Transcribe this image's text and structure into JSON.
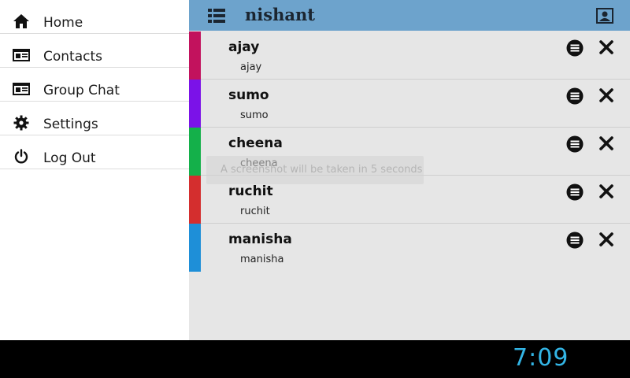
{
  "sidebar": {
    "items": [
      {
        "label": "Home",
        "icon": "home-icon"
      },
      {
        "label": "Contacts",
        "icon": "contact-card-icon"
      },
      {
        "label": "Group Chat",
        "icon": "contact-card-icon"
      },
      {
        "label": "Settings",
        "icon": "gear-icon"
      },
      {
        "label": "Log Out",
        "icon": "power-icon"
      }
    ]
  },
  "header": {
    "title": "nishant",
    "bg_color": "#6da3cc"
  },
  "contacts": [
    {
      "name": "ajay",
      "sub": "ajay",
      "color": "#c2125d"
    },
    {
      "name": "sumo",
      "sub": "sumo",
      "color": "#7b12e8"
    },
    {
      "name": "cheena",
      "sub": "cheena",
      "color": "#14b04a"
    },
    {
      "name": "ruchit",
      "sub": "ruchit",
      "color": "#d42e2e"
    },
    {
      "name": "manisha",
      "sub": "manisha",
      "color": "#1e8fd8"
    }
  ],
  "toast": {
    "text": "A screenshot will be taken in 5 seconds"
  },
  "system_bar": {
    "time": "7:09",
    "accent": "#33b5e5"
  }
}
